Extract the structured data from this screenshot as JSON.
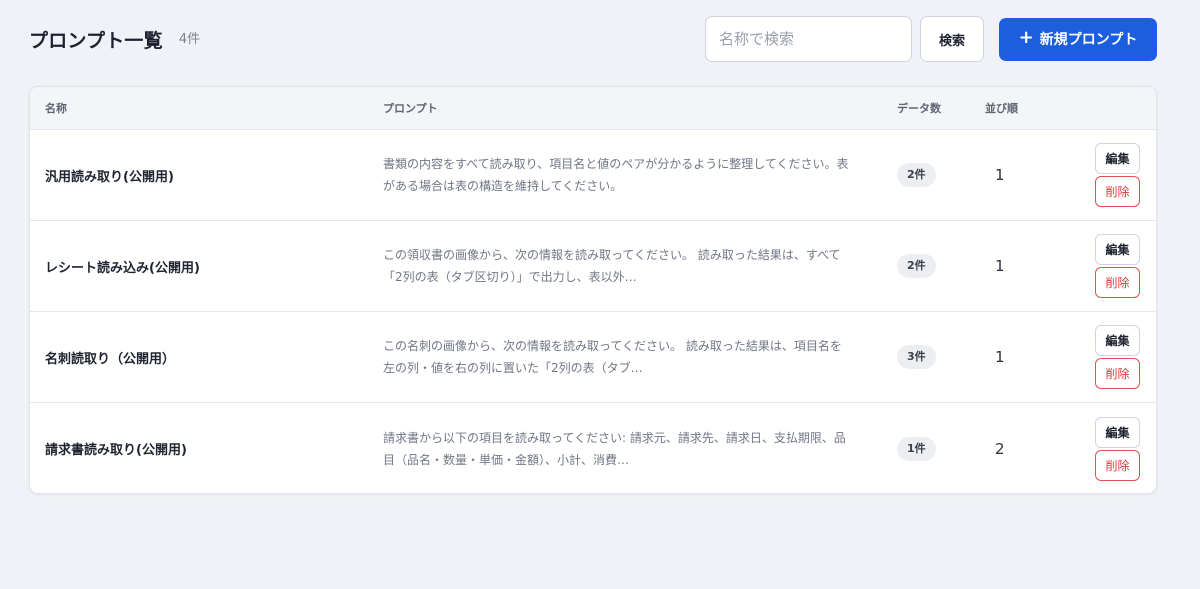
{
  "header": {
    "title": "プロンプト一覧",
    "count": "4件",
    "search_placeholder": "名称で検索",
    "search_value": "",
    "search_button": "検索",
    "new_button": "新規プロンプト",
    "plus_symbol": "+"
  },
  "table": {
    "columns": {
      "name": "名称",
      "prompt": "プロンプト",
      "data_count": "データ数",
      "order": "並び順"
    },
    "edit_label": "編集",
    "delete_label": "削除",
    "rows": [
      {
        "name": "汎用読み取り(公開用)",
        "prompt": "書類の内容をすべて読み取り、項目名と値のペアが分かるように整理してください。表がある場合は表の構造を維持してください。",
        "count": "2件",
        "order": "1"
      },
      {
        "name": "レシート読み込み(公開用)",
        "prompt": "この領収書の画像から、次の情報を読み取ってください。 読み取った結果は、すべて「2列の表（タブ区切り）」で出力し、表以外…",
        "count": "2件",
        "order": "1"
      },
      {
        "name": "名刺読取り（公開用）",
        "prompt": "この名刺の画像から、次の情報を読み取ってください。 読み取った結果は、項目名を左の列・値を右の列に置いた「2列の表（タブ…",
        "count": "3件",
        "order": "1"
      },
      {
        "name": "請求書読み取り(公開用)",
        "prompt": "請求書から以下の項目を読み取ってください: 請求元、請求先、請求日、支払期限、品目（品名・数量・単価・金額）、小計、消費…",
        "count": "1件",
        "order": "2"
      }
    ]
  },
  "colors": {
    "primary": "#1d5ede",
    "danger": "#d63b3b",
    "background": "#f0f2f7"
  }
}
